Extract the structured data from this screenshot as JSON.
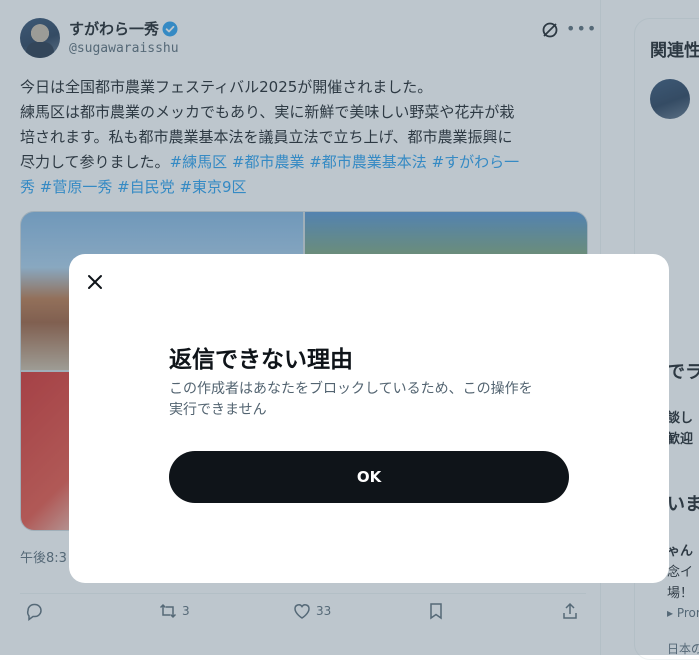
{
  "tweet": {
    "author_name": "すがわら一秀",
    "author_handle": "@sugawaraisshu",
    "text_line1": "今日は全国都市農業フェスティバル2025が開催されました。",
    "text_line2": "練馬区は都市農業のメッカでもあり、実に新鮮で美味しい野菜や花卉が栽",
    "text_line3": "培されます。私も都市農業基本法を議員立法で立ち上げ、都市農業振興に",
    "text_line4_plain": "尽力して参りました。",
    "hashtags_line4": "#練馬区 #都市農業 #都市農業基本法 #すがわら一",
    "hashtags_line5": "秀 #菅原一秀 #自民党 #東京9区",
    "timestamp": "午後8:3",
    "retweet_count": "3",
    "like_count": "33"
  },
  "sidebar": {
    "title": "関連性",
    "snippet1": "でラ",
    "snippet2": "談し",
    "snippet3": "歓迎",
    "snippet4": "いま",
    "snippet5": "ゃん",
    "snippet6": "念イ",
    "snippet7": "場！",
    "snippet8": "Promo",
    "snippet9": "日本のト"
  },
  "modal": {
    "title": "返信できない理由",
    "body_line1": "この作成者はあなたをブロックしているため、この操作を",
    "body_line2": "実行できません",
    "ok_label": "OK"
  },
  "colors": {
    "accent": "#1d9bf0",
    "text_primary": "#0f1419",
    "text_secondary": "#536471",
    "button_bg": "#0f1419",
    "overlay": "rgba(91,112,131,0.40)"
  },
  "icons": [
    "verified-badge-icon",
    "grok-icon",
    "more-icon",
    "close-icon",
    "reply-icon",
    "retweet-icon",
    "like-icon",
    "bookmark-icon",
    "share-icon"
  ]
}
